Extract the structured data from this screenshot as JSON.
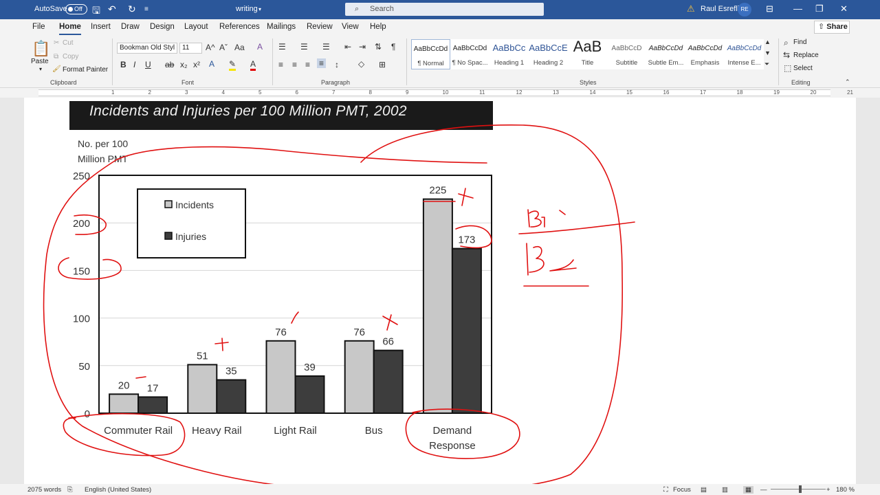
{
  "titlebar": {
    "autosave_label": "AutoSave",
    "autosave_state": "Off",
    "document_name": "writing",
    "search_placeholder": "Search",
    "user_name": "Raul Esrefli",
    "user_initials": "RE"
  },
  "tabs": [
    "File",
    "Home",
    "Insert",
    "Draw",
    "Design",
    "Layout",
    "References",
    "Mailings",
    "Review",
    "View",
    "Help"
  ],
  "active_tab": "Home",
  "share_label": "Share",
  "ribbon": {
    "clipboard": {
      "paste": "Paste",
      "cut": "Cut",
      "copy": "Copy",
      "format_painter": "Format Painter",
      "label": "Clipboard"
    },
    "font": {
      "name": "Bookman Old Styl",
      "size": "11",
      "label": "Font"
    },
    "paragraph": {
      "label": "Paragraph"
    },
    "styles": {
      "label": "Styles",
      "items": [
        {
          "sample": "AaBbCcDd",
          "name": "¶ Normal"
        },
        {
          "sample": "AaBbCcDd",
          "name": "¶ No Spac..."
        },
        {
          "sample": "AaBbCc",
          "name": "Heading 1"
        },
        {
          "sample": "AaBbCcE",
          "name": "Heading 2"
        },
        {
          "sample": "AaB",
          "name": "Title"
        },
        {
          "sample": "AaBbCcD",
          "name": "Subtitle"
        },
        {
          "sample": "AaBbCcDd",
          "name": "Subtle Em..."
        },
        {
          "sample": "AaBbCcDd",
          "name": "Emphasis"
        },
        {
          "sample": "AaBbCcDd",
          "name": "Intense E..."
        }
      ]
    },
    "editing": {
      "find": "Find",
      "replace": "Replace",
      "select": "Select",
      "label": "Editing"
    }
  },
  "ruler_numbers": [
    "1",
    "2",
    "3",
    "4",
    "5",
    "6",
    "7",
    "8",
    "9",
    "10",
    "11",
    "12",
    "13",
    "14",
    "15",
    "16",
    "17",
    "18",
    "19",
    "20",
    "21"
  ],
  "status": {
    "words": "2075 words",
    "language": "English (United States)",
    "focus": "Focus",
    "zoom": "180 %"
  },
  "chart_data": {
    "type": "bar",
    "title": "Incidents and Injuries per 100 Million PMT, 2002",
    "ylabel_line1": "No. per 100",
    "ylabel_line2": "Million PMT",
    "ylim": [
      0,
      250
    ],
    "yticks": [
      "0",
      "50",
      "100",
      "150",
      "200",
      "250"
    ],
    "categories": [
      "Commuter Rail",
      "Heavy Rail",
      "Light Rail",
      "Bus",
      "Demand Response"
    ],
    "series": [
      {
        "name": "Incidents",
        "values": [
          20,
          51,
          76,
          76,
          225
        ]
      },
      {
        "name": "Injuries",
        "values": [
          17,
          35,
          39,
          66,
          173
        ]
      }
    ],
    "legend_position": "top-left",
    "grid": true,
    "colors": {
      "incidents": "#c8c8c8",
      "injuries": "#3d3d3d"
    }
  },
  "handwriting": {
    "line1": "B1",
    "line2": "B2"
  }
}
